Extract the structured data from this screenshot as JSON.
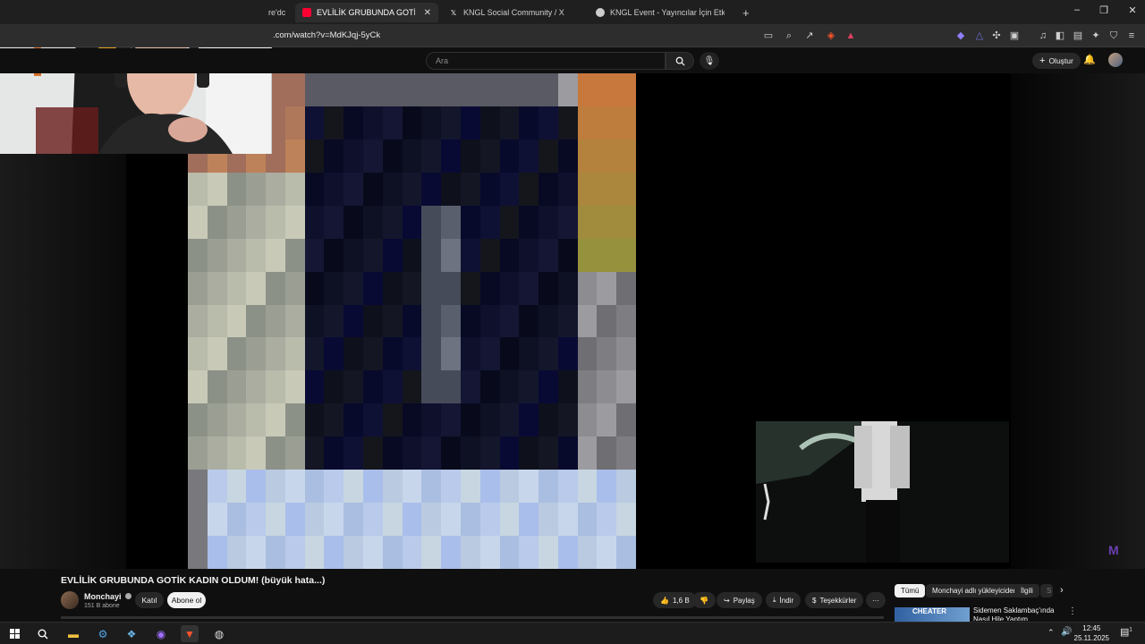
{
  "browser": {
    "tabs": [
      {
        "label": "re'dc",
        "favicon": "youtube-icon"
      },
      {
        "label": "EVLİLİK GRUBUNDA GOTİK KADIN",
        "favicon": "youtube-icon",
        "active": true
      },
      {
        "label": "KNGL Social Community / X",
        "favicon": "x-icon"
      },
      {
        "label": "KNGL Event - Yayıncılar İçin Etkinlik v",
        "favicon": "shield-icon"
      }
    ],
    "new_tab": "+",
    "url": ".com/watch?v=MdKJqj-5yCk",
    "window_controls": [
      "–",
      "❐",
      "✕"
    ]
  },
  "youtube": {
    "search_placeholder": "Ara",
    "create_label": "Oluştur",
    "video_title": "EVLİLİK GRUBUNDA GOTİK KADIN OLDUM! (büyük hata...)",
    "channel_name": "Monchayi",
    "subscribers": "151 B abone",
    "join_label": "Katıl",
    "subscribe_label": "Abone ol",
    "likes": "1,6 B",
    "share_label": "Paylaş",
    "download_label": "İndir",
    "thanks_label": "Teşekkürler",
    "more_label": "···",
    "chips": [
      "Tümü",
      "Monchayi adlı yükleyiciden",
      "İlgili",
      "S"
    ],
    "recommended": {
      "thumb_text": "CHEATER",
      "title": "Sidemen Saklambaç'ında Nasıl Hile Yaptım"
    },
    "watermark": "M"
  },
  "taskbar": {
    "time": "12:45",
    "date": "25.11.2025",
    "notification_count": "1"
  },
  "colors": {
    "accent_red": "#ff0033",
    "background": "#0f0f0f",
    "chip_active": "#f1f1f1"
  }
}
